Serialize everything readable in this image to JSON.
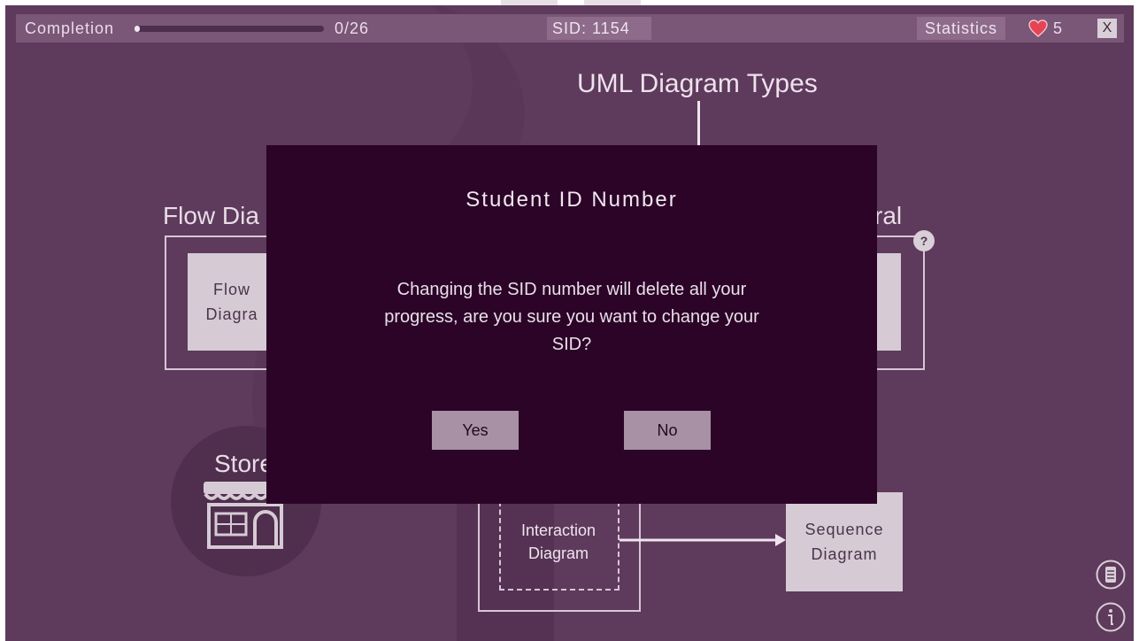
{
  "topbar": {
    "completion_label": "Completion",
    "progress_count": "0/26",
    "progress_fraction": 0.02,
    "sid_text": "SID: 1154",
    "statistics_label": "Statistics",
    "lives": "5",
    "close_label": "X"
  },
  "diagram": {
    "title": "UML Diagram Types",
    "flow_section_label": "Flow Dia",
    "behavioral_section_label": "ral",
    "flow_tile_label": "Flow\nDiagra",
    "help_label": "?",
    "store_label": "Store",
    "interaction_tile_label": "Interaction\nDiagram",
    "sequence_tile_label": "Sequence\nDiagram"
  },
  "modal": {
    "title": "Student ID Number",
    "message": "Changing the SID number will delete all your progress, are you sure you want to change your SID?",
    "yes_label": "Yes",
    "no_label": "No"
  },
  "colors": {
    "background": "#5e3a5c",
    "topbar": "#7a5677",
    "modal": "#2b0428",
    "button": "#a891a5",
    "heart": "#e64455"
  }
}
